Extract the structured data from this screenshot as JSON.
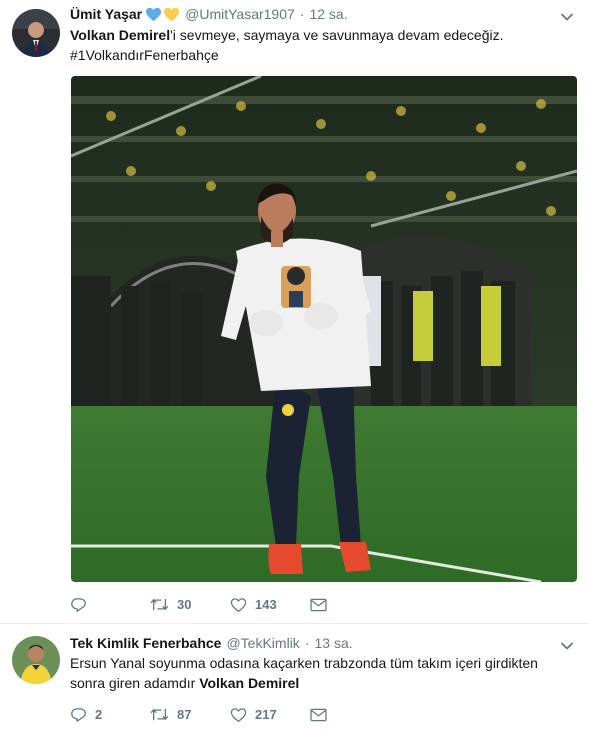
{
  "tweets": [
    {
      "author_name": "Ümit Yaşar",
      "handle": "@UmitYasar1907",
      "separator": "·",
      "time": "12 sa.",
      "text_bold": "Volkan Demirel",
      "text_rest": "'i sevmeye, saymaya ve savunmaya devam edeceğiz.",
      "hashtag": "#1VolkandırFenerbahçe",
      "reply_count": "",
      "retweet_count": "30",
      "like_count": "143"
    },
    {
      "author_name": "Tek Kimlik Fenerbahce",
      "handle": "@TekKimlik",
      "separator": "·",
      "time": "13 sa.",
      "text": "Ersun Yanal soyunma odasına kaçarken trabzonda  tüm takım içeri girdikten sonra giren adamdır",
      "text_bold": "Volkan Demirel",
      "reply_count": "2",
      "retweet_count": "87",
      "like_count": "217"
    }
  ],
  "icons": {
    "blue_heart": "#5dadec",
    "yellow_heart": "#ffcc4d",
    "action_color": "#657786"
  }
}
